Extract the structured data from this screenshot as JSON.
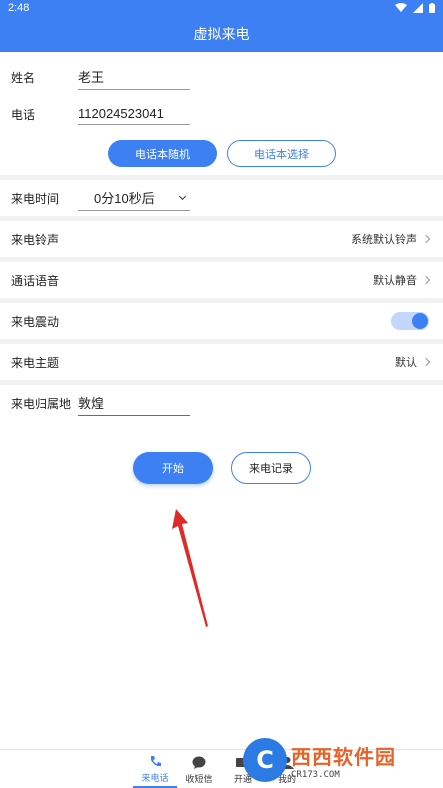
{
  "status": {
    "time": "2:48"
  },
  "title": "虚拟来电",
  "form": {
    "name_label": "姓名",
    "name_value": "老王",
    "phone_label": "电话",
    "phone_value": "112024523041",
    "random_button": "电话本随机",
    "select_button": "电话本选择"
  },
  "rows": {
    "time_label": "来电时间",
    "time_value": "0分10秒后",
    "ringtone_label": "来电铃声",
    "ringtone_value": "系统默认铃声",
    "voice_label": "通话语音",
    "voice_value": "默认静音",
    "vibrate_label": "来电震动",
    "vibrate_on": true,
    "theme_label": "来电主题",
    "theme_value": "默认",
    "location_label": "来电归属地",
    "location_value": "敦煌"
  },
  "actions": {
    "start": "开始",
    "history": "来电记录"
  },
  "nav": [
    {
      "label": "来电话",
      "icon": "phone-icon",
      "active": true
    },
    {
      "label": "收短信",
      "icon": "chat-icon",
      "active": false
    },
    {
      "label": "开通",
      "icon": "card-icon",
      "active": false
    },
    {
      "label": "我的",
      "icon": "user-icon",
      "active": false
    }
  ],
  "watermark": {
    "main": "西西软件园",
    "sub": "CR173.COM"
  },
  "colors": {
    "accent": "#3d80f4",
    "focus_underline": "#d5386a",
    "arrow": "#e02a2a"
  }
}
